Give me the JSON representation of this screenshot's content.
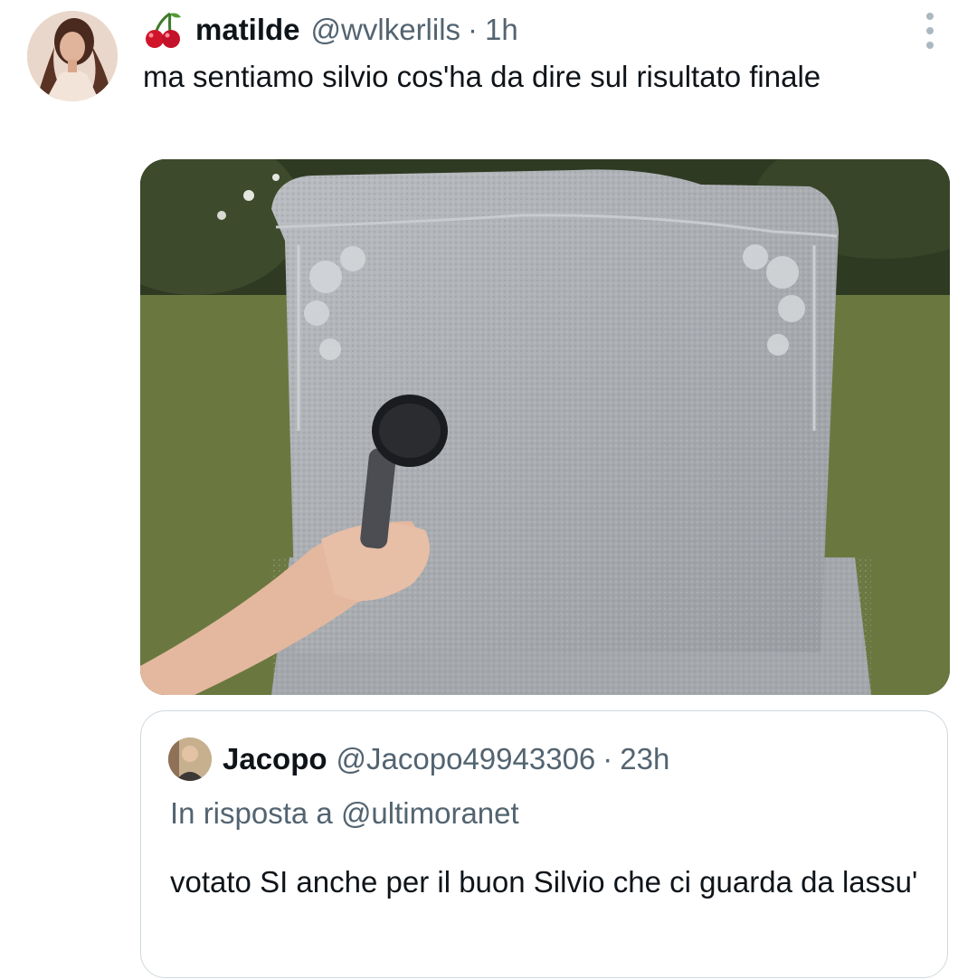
{
  "tweet": {
    "author_name": "matilde",
    "author_handle": "@wvlkerlils",
    "separator": "·",
    "time": "1h",
    "emoji_icon": "cherry-icon",
    "text": "ma sentiamo silvio cos'ha da dire sul risultato finale"
  },
  "quote": {
    "author_name": "Jacopo",
    "author_handle": "@Jacopo49943306",
    "separator": "·",
    "time": "23h",
    "reply_prefix": "In risposta a",
    "reply_to": "@ultimoranet",
    "text": "votato SI anche per il buon Silvio che ci guarda da lassu'"
  },
  "colors": {
    "primary_text": "#0f1419",
    "secondary_text": "#536471",
    "border": "#cfd9de"
  }
}
